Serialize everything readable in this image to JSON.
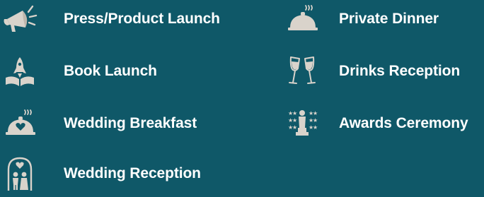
{
  "colors": {
    "background": "#0f5868",
    "text": "#ffffff",
    "icon": "#d9d3cb"
  },
  "events": {
    "items": [
      {
        "label": "Press/Product Launch",
        "icon": "megaphone-icon"
      },
      {
        "label": "Private Dinner",
        "icon": "cloche-icon"
      },
      {
        "label": "Book Launch",
        "icon": "rocket-book-icon"
      },
      {
        "label": "Drinks Reception",
        "icon": "champagne-glasses-icon"
      },
      {
        "label": "Wedding Breakfast",
        "icon": "heart-cloche-icon"
      },
      {
        "label": "Awards Ceremony",
        "icon": "trophy-stars-icon"
      },
      {
        "label": "Wedding Reception",
        "icon": "couple-arch-icon"
      }
    ]
  }
}
